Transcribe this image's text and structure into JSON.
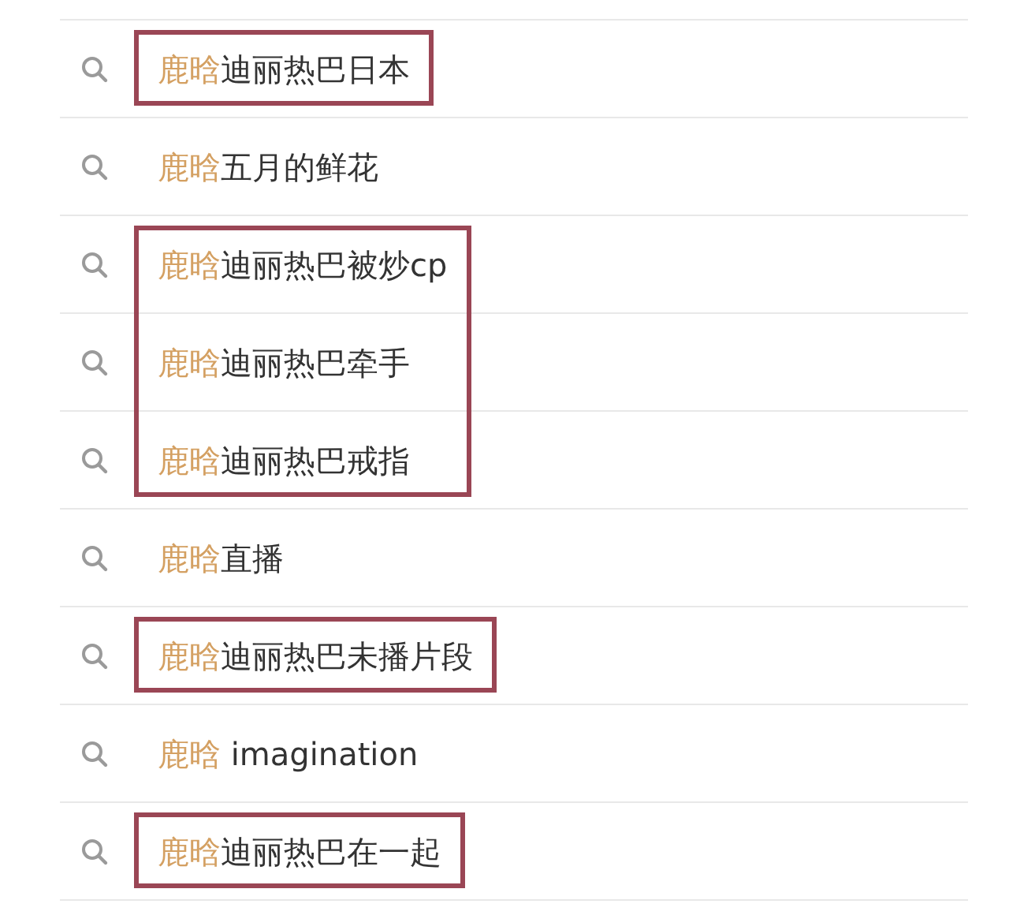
{
  "suggestion_groups": [
    {
      "boxed": true,
      "items": [
        {
          "match": "鹿晗",
          "rest": "迪丽热巴日本"
        }
      ]
    },
    {
      "boxed": false,
      "items": [
        {
          "match": "鹿晗",
          "rest": "五月的鲜花"
        }
      ]
    },
    {
      "boxed": true,
      "items": [
        {
          "match": "鹿晗",
          "rest": "迪丽热巴被炒cp"
        },
        {
          "match": "鹿晗",
          "rest": "迪丽热巴牵手"
        },
        {
          "match": "鹿晗",
          "rest": "迪丽热巴戒指"
        }
      ]
    },
    {
      "boxed": false,
      "items": [
        {
          "match": "鹿晗",
          "rest": "直播"
        }
      ]
    },
    {
      "boxed": true,
      "items": [
        {
          "match": "鹿晗",
          "rest": "迪丽热巴未播片段"
        }
      ]
    },
    {
      "boxed": false,
      "items": [
        {
          "match": "鹿晗",
          "rest": " imagination"
        }
      ]
    },
    {
      "boxed": true,
      "items": [
        {
          "match": "鹿晗",
          "rest": "迪丽热巴在一起"
        }
      ]
    }
  ]
}
